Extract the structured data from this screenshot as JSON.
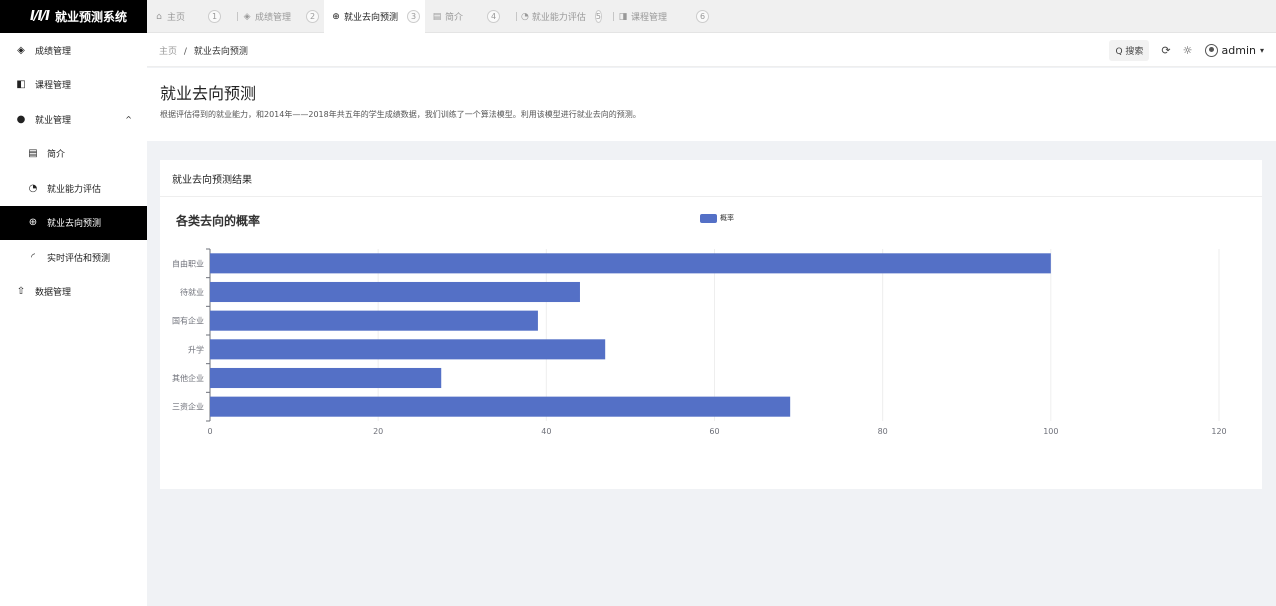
{
  "app": {
    "logo_mark": "I/I/I",
    "title": "就业预测系统"
  },
  "tabs": [
    {
      "icon": "⌂",
      "label": "主页",
      "num": "1",
      "active": false
    },
    {
      "icon": "◈",
      "label": "成绩管理",
      "num": "2",
      "active": false
    },
    {
      "icon": "⊕",
      "label": "就业去向预测",
      "num": "3",
      "active": true
    },
    {
      "icon": "▤",
      "label": "简介",
      "num": "4",
      "active": false
    },
    {
      "icon": "◔",
      "label": "就业能力评估",
      "num": "5",
      "active": false
    },
    {
      "icon": "◨",
      "label": "课程管理",
      "num": "6",
      "active": false
    }
  ],
  "sidebar": {
    "items": [
      {
        "icon": "◈",
        "label": "成绩管理"
      },
      {
        "icon": "◧",
        "label": "课程管理"
      },
      {
        "icon": "●",
        "label": "就业管理",
        "caret": "^"
      },
      {
        "icon": "▤",
        "label": "简介"
      },
      {
        "icon": "◔",
        "label": "就业能力评估"
      },
      {
        "icon": "⊕",
        "label": "就业去向预测"
      },
      {
        "icon": "◜",
        "label": "实时评估和预测"
      },
      {
        "icon": "⇧",
        "label": "数据管理"
      }
    ]
  },
  "header": {
    "breadcrumb_home": "主页",
    "breadcrumb_sep": "/",
    "breadcrumb_current": "就业去向预测",
    "search_label": "Q 搜索",
    "refresh_icon": "⟳",
    "theme_icon": "☼",
    "user": "admin",
    "user_caret": "▾"
  },
  "page": {
    "title": "就业去向预测",
    "description": "根据评估得到的就业能力，和2014年——2018年共五年的学生成绩数据，我们训练了一个算法模型。利用该模型进行就业去向的预测。"
  },
  "card": {
    "title": "就业去向预测结果"
  },
  "chart_data": {
    "type": "bar",
    "orientation": "horizontal",
    "title": "各类去向的概率",
    "legend": [
      "概率"
    ],
    "legend_position": "top-center",
    "color": "#5470c6",
    "categories": [
      "三资企业",
      "其他企业",
      "升学",
      "国有企业",
      "待就业",
      "自由职业"
    ],
    "series": [
      {
        "name": "概率",
        "values": [
          69,
          27.5,
          47,
          39,
          44,
          100
        ]
      }
    ],
    "xlim": [
      0,
      120
    ],
    "xticks": [
      "0",
      "20",
      "40",
      "60",
      "80",
      "100",
      "120"
    ],
    "grid": true
  }
}
